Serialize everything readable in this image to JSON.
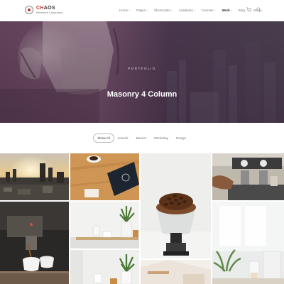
{
  "brand": {
    "name_part1": "CH",
    "name_part2": "AOS",
    "tagline": "Research Laboratory"
  },
  "nav": [
    {
      "label": "Home",
      "caret": "˅"
    },
    {
      "label": "Pages",
      "caret": "˅"
    },
    {
      "label": "Shortcodes",
      "caret": "˅"
    },
    {
      "label": "Academia",
      "caret": "˅"
    },
    {
      "label": "Courses",
      "caret": "˅"
    },
    {
      "label": "Work",
      "caret": "˅"
    },
    {
      "label": "Blog",
      "caret": "˅"
    },
    {
      "label": "Shop",
      "caret": "˅"
    }
  ],
  "active_nav": "Work",
  "icons": {
    "cart": "cart-icon",
    "search": "search-icon",
    "logo": "logo-mark-icon"
  },
  "hero": {
    "subtitle": "PORTFOLIO",
    "title": "Masonry 4 Column"
  },
  "filters": [
    "Show All",
    "Artwork",
    "Banner",
    "Marketing",
    "Design"
  ],
  "active_filter": "Show All",
  "colors": {
    "brand_red": "#c0392b",
    "hero_tint": "#5a3a54",
    "text_dark": "#222222",
    "text_muted": "#777777"
  },
  "portfolio": [
    {
      "name": "portfolio-item-city-sunset"
    },
    {
      "name": "portfolio-item-coffee-table"
    },
    {
      "name": "portfolio-item-coffee-beans-grinder"
    },
    {
      "name": "portfolio-item-espresso-machine"
    },
    {
      "name": "portfolio-item-espresso-cups"
    },
    {
      "name": "portfolio-item-plant-shelf"
    },
    {
      "name": "portfolio-item-window-plant"
    },
    {
      "name": "portfolio-item-wall-shelf"
    },
    {
      "name": "portfolio-item-cafe-interior"
    }
  ]
}
